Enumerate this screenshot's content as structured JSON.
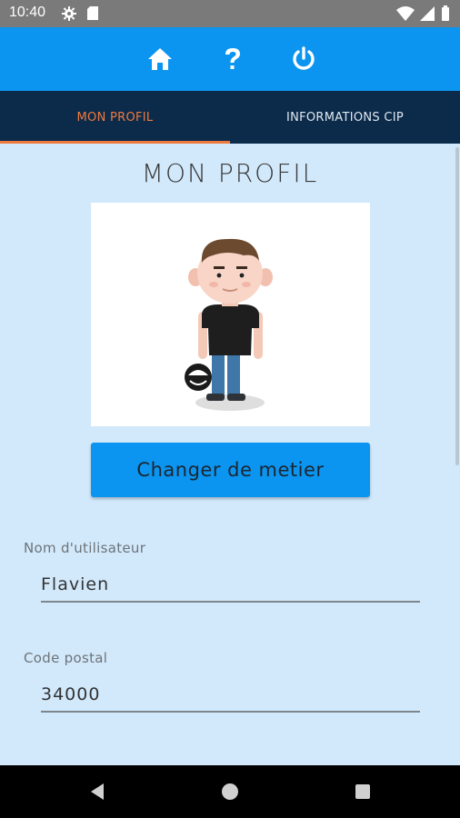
{
  "status_bar": {
    "time": "10:40",
    "icons": [
      "gear-icon",
      "sd-card-icon",
      "wifi-icon",
      "signal-icon",
      "battery-icon"
    ]
  },
  "app_bar": {
    "icons": [
      "home-icon",
      "help-icon",
      "power-icon"
    ],
    "color": "#0b95f0"
  },
  "tabs": [
    {
      "label": "MON PROFIL",
      "active": true
    },
    {
      "label": "INFORMATIONS CIP",
      "active": false
    }
  ],
  "profile": {
    "title": "MON PROFIL",
    "change_button": "Changer de metier",
    "fields": [
      {
        "label": "Nom d'utilisateur",
        "value": "Flavien"
      },
      {
        "label": "Code postal",
        "value": "34000"
      }
    ]
  },
  "colors": {
    "accent": "#ef7a3d",
    "tab_bar": "#0c2b4b",
    "background": "#d2e9fb"
  },
  "nav_bar": {
    "icons": [
      "back-icon",
      "home-circle-icon",
      "recents-icon"
    ]
  }
}
